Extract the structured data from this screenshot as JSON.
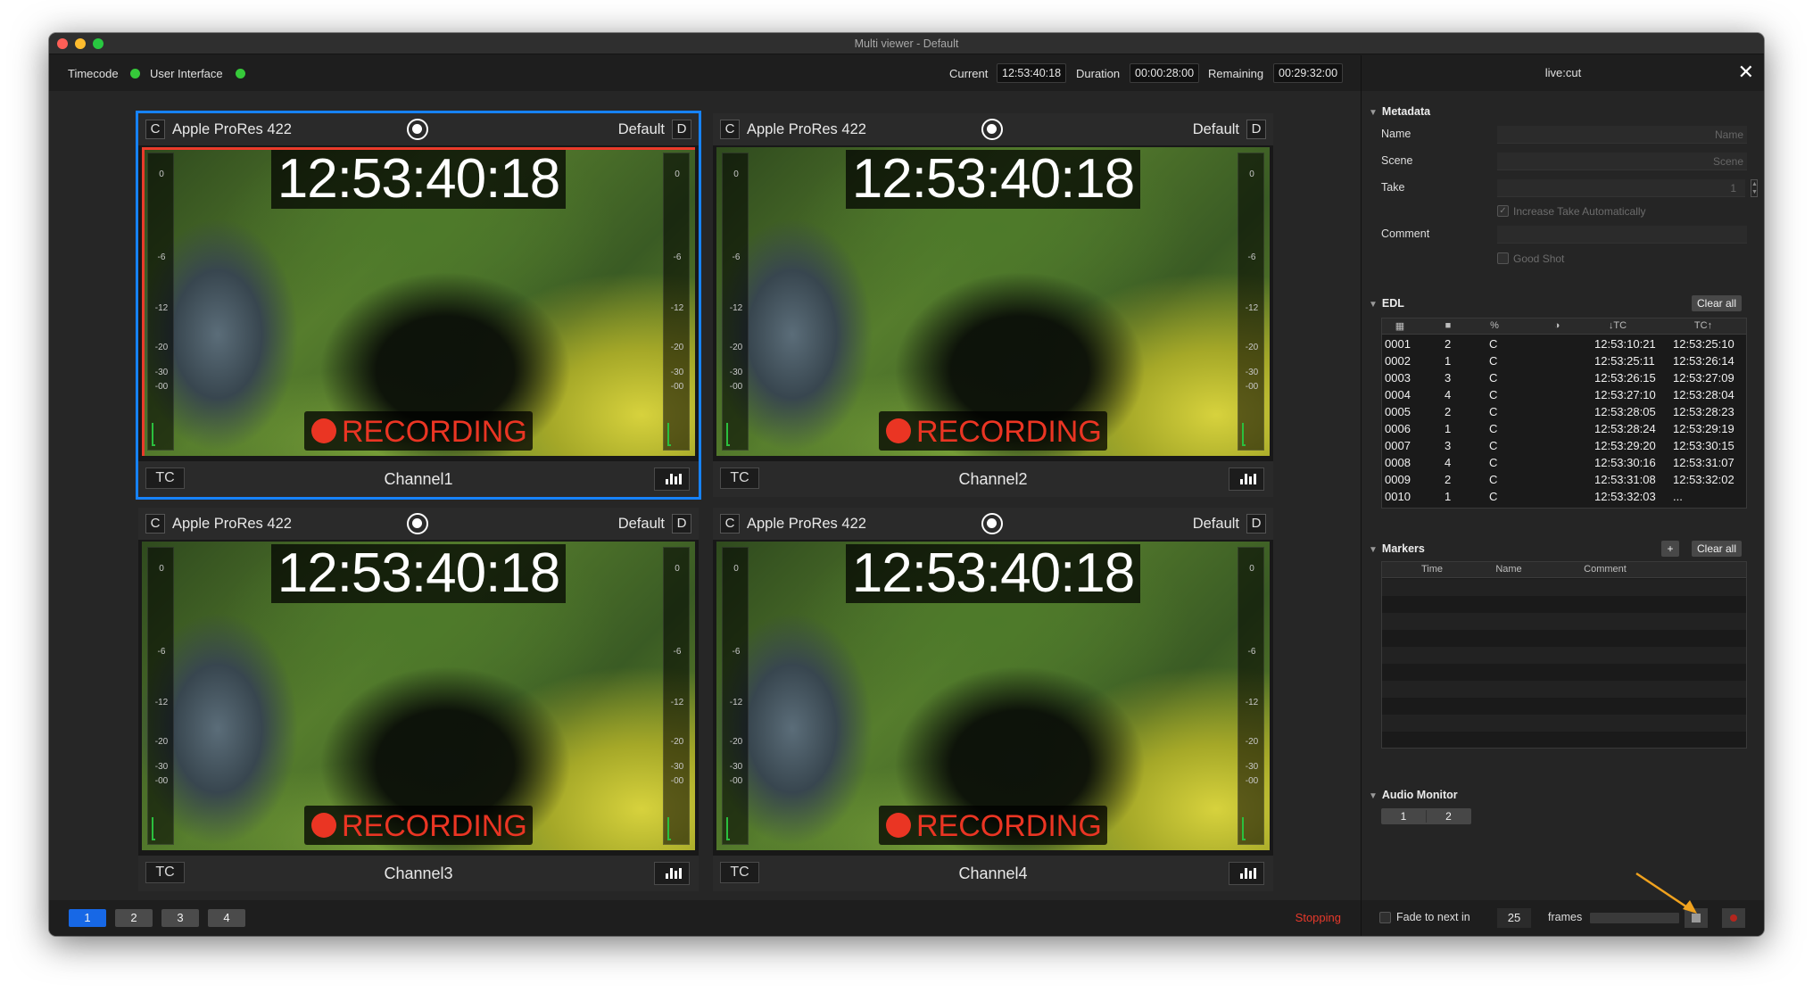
{
  "window": {
    "title": "Multi viewer - Default"
  },
  "topbar": {
    "timecode_label": "Timecode",
    "ui_label": "User Interface",
    "current_label": "Current",
    "current_value": "12:53:40:18",
    "duration_label": "Duration",
    "duration_value": "00:00:28:00",
    "remaining_label": "Remaining",
    "remaining_value": "00:29:32:00"
  },
  "tiles": [
    {
      "c_chip": "C",
      "codec": "Apple ProRes 422",
      "preset": "Default",
      "d_chip": "D",
      "timecode": "12:53:40:18",
      "recording": "RECORDING",
      "tc_chip": "TC",
      "channel": "Channel1",
      "selected": true
    },
    {
      "c_chip": "C",
      "codec": "Apple ProRes 422",
      "preset": "Default",
      "d_chip": "D",
      "timecode": "12:53:40:18",
      "recording": "RECORDING",
      "tc_chip": "TC",
      "channel": "Channel2",
      "selected": false
    },
    {
      "c_chip": "C",
      "codec": "Apple ProRes 422",
      "preset": "Default",
      "d_chip": "D",
      "timecode": "12:53:40:18",
      "recording": "RECORDING",
      "tc_chip": "TC",
      "channel": "Channel3",
      "selected": false
    },
    {
      "c_chip": "C",
      "codec": "Apple ProRes 422",
      "preset": "Default",
      "d_chip": "D",
      "timecode": "12:53:40:18",
      "recording": "RECORDING",
      "tc_chip": "TC",
      "channel": "Channel4",
      "selected": false
    }
  ],
  "meter_ticks": [
    "0",
    "-6",
    "-12",
    "-20",
    "-30",
    "-00"
  ],
  "bottombar": {
    "pages": [
      "1",
      "2",
      "3",
      "4"
    ],
    "active_page": "1",
    "status": "Stopping"
  },
  "panel": {
    "title": "live:cut",
    "close_icon": "close-icon",
    "metadata": {
      "heading": "Metadata",
      "name_label": "Name",
      "name_placeholder": "Name",
      "scene_label": "Scene",
      "scene_placeholder": "Scene",
      "take_label": "Take",
      "take_value": "1",
      "increase_take": "Increase Take Automatically",
      "comment_label": "Comment",
      "good_shot": "Good Shot"
    },
    "edl": {
      "heading": "EDL",
      "clear_all": "Clear all",
      "columns": [
        "calendar-icon",
        "camera-icon",
        "%",
        "clock-icon",
        "↓TC",
        "TC↑"
      ],
      "rows": [
        {
          "id": "0001",
          "cam": "2",
          "type": "C",
          "tc_in": "12:53:10:21",
          "tc_out": "12:53:25:10"
        },
        {
          "id": "0002",
          "cam": "1",
          "type": "C",
          "tc_in": "12:53:25:11",
          "tc_out": "12:53:26:14"
        },
        {
          "id": "0003",
          "cam": "3",
          "type": "C",
          "tc_in": "12:53:26:15",
          "tc_out": "12:53:27:09"
        },
        {
          "id": "0004",
          "cam": "4",
          "type": "C",
          "tc_in": "12:53:27:10",
          "tc_out": "12:53:28:04"
        },
        {
          "id": "0005",
          "cam": "2",
          "type": "C",
          "tc_in": "12:53:28:05",
          "tc_out": "12:53:28:23"
        },
        {
          "id": "0006",
          "cam": "1",
          "type": "C",
          "tc_in": "12:53:28:24",
          "tc_out": "12:53:29:19"
        },
        {
          "id": "0007",
          "cam": "3",
          "type": "C",
          "tc_in": "12:53:29:20",
          "tc_out": "12:53:30:15"
        },
        {
          "id": "0008",
          "cam": "4",
          "type": "C",
          "tc_in": "12:53:30:16",
          "tc_out": "12:53:31:07"
        },
        {
          "id": "0009",
          "cam": "2",
          "type": "C",
          "tc_in": "12:53:31:08",
          "tc_out": "12:53:32:02"
        },
        {
          "id": "0010",
          "cam": "1",
          "type": "C",
          "tc_in": "12:53:32:03",
          "tc_out": "..."
        }
      ]
    },
    "markers": {
      "heading": "Markers",
      "add": "+",
      "clear_all": "Clear all",
      "columns": [
        "Time",
        "Name",
        "Comment"
      ]
    },
    "audio_monitor": {
      "heading": "Audio Monitor",
      "channels": [
        "1",
        "2"
      ]
    },
    "bottom": {
      "fade_label": "Fade to next in",
      "frames_value": "25",
      "frames_label": "frames"
    }
  },
  "colors": {
    "accent_blue": "#1682ff",
    "record_red": "#ea3523",
    "status_green": "#36c93a"
  }
}
